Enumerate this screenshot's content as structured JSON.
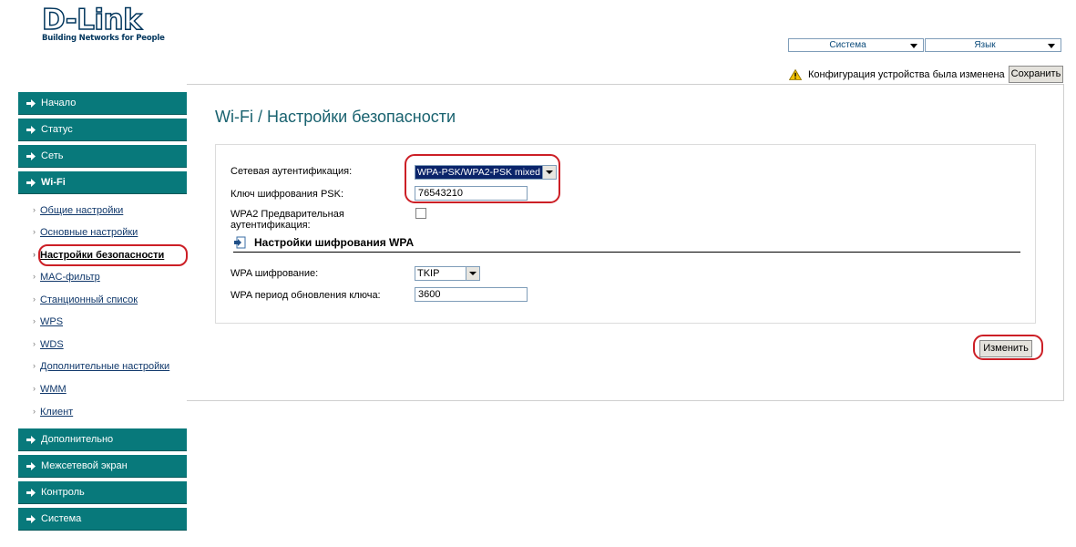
{
  "brand": {
    "logo_text": "D-Link",
    "tagline": "Building Networks for People"
  },
  "header": {
    "system_select": "Система",
    "language_select": "Язык",
    "config_notice": "Конфигурация устройства была изменена",
    "save_label": "Сохранить"
  },
  "sidebar": {
    "items": [
      {
        "label": "Начало"
      },
      {
        "label": "Статус"
      },
      {
        "label": "Сеть"
      },
      {
        "label": "Wi-Fi"
      },
      {
        "label": "Дополнительно"
      },
      {
        "label": "Межсетевой экран"
      },
      {
        "label": "Контроль"
      },
      {
        "label": "Система"
      }
    ],
    "wifi_subitems": [
      {
        "label": "Общие настройки"
      },
      {
        "label": "Основные настройки"
      },
      {
        "label": "Настройки безопасности"
      },
      {
        "label": "MAC-фильтр"
      },
      {
        "label": "Станционный список"
      },
      {
        "label": "WPS"
      },
      {
        "label": "WDS"
      },
      {
        "label": "Дополнительные настройки"
      },
      {
        "label": "WMM"
      },
      {
        "label": "Клиент"
      }
    ]
  },
  "main": {
    "page_title": "Wi-Fi  / Настройки безопасности",
    "fields": {
      "auth_label": "Сетевая аутентификация:",
      "auth_value": "WPA-PSK/WPA2-PSK mixed",
      "psk_label": "Ключ шифрования PSK:",
      "psk_value": "76543210",
      "preauth_label_line1": "WPA2 Предварительная",
      "preauth_label_line2": "аутентификация:",
      "section_title": "Настройки шифрования WPA",
      "wpa_enc_label": "WPA шифрование:",
      "wpa_enc_value": "TKIP",
      "rekey_label": "WPA период обновления ключа:",
      "rekey_value": "3600"
    },
    "change_label": "Изменить"
  },
  "colors": {
    "menu_bg": "#08797b",
    "title_color": "#19626f",
    "highlight_red": "#cc1f26",
    "selected_bg": "#0a246a"
  }
}
